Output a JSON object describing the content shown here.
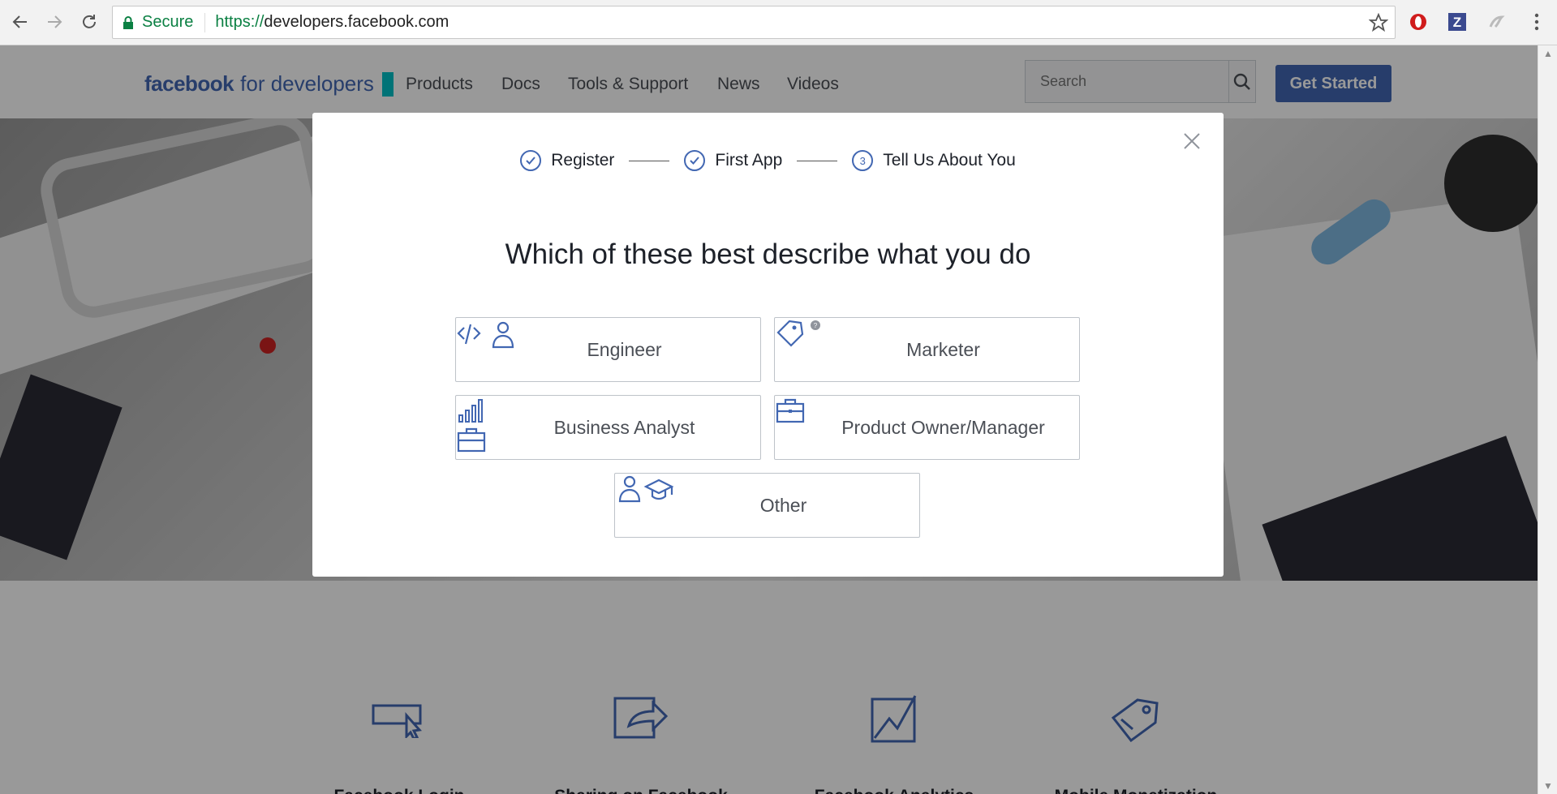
{
  "browser": {
    "secure_label": "Secure",
    "url_protocol": "https://",
    "url_host": "developers.facebook.com"
  },
  "header": {
    "logo_facebook": "facebook",
    "logo_suffix": "for developers",
    "nav": [
      "Products",
      "Docs",
      "Tools & Support",
      "News",
      "Videos"
    ],
    "search_placeholder": "Search",
    "get_started": "Get Started"
  },
  "modal": {
    "steps": [
      {
        "label": "Register",
        "state": "done"
      },
      {
        "label": "First App",
        "state": "done"
      },
      {
        "label": "Tell Us About You",
        "state": "current",
        "number": "3"
      }
    ],
    "title": "Which of these best describe what you do",
    "roles": [
      {
        "label": "Engineer",
        "icon": "engineer-icon"
      },
      {
        "label": "Marketer",
        "icon": "marketer-icon"
      },
      {
        "label": "Business Analyst",
        "icon": "business-analyst-icon"
      },
      {
        "label": "Product Owner/Manager",
        "icon": "briefcase-icon"
      },
      {
        "label": "Other",
        "icon": "student-icon"
      }
    ]
  },
  "features": [
    {
      "title": "Facebook Login",
      "icon": "login-icon"
    },
    {
      "title": "Sharing on Facebook",
      "icon": "share-icon"
    },
    {
      "title": "Facebook Analytics",
      "icon": "analytics-icon"
    },
    {
      "title": "Mobile Monetization",
      "icon": "monetization-icon"
    }
  ],
  "colors": {
    "brand": "#4267b2",
    "accent": "#00c0c7",
    "secure": "#0b8043"
  }
}
